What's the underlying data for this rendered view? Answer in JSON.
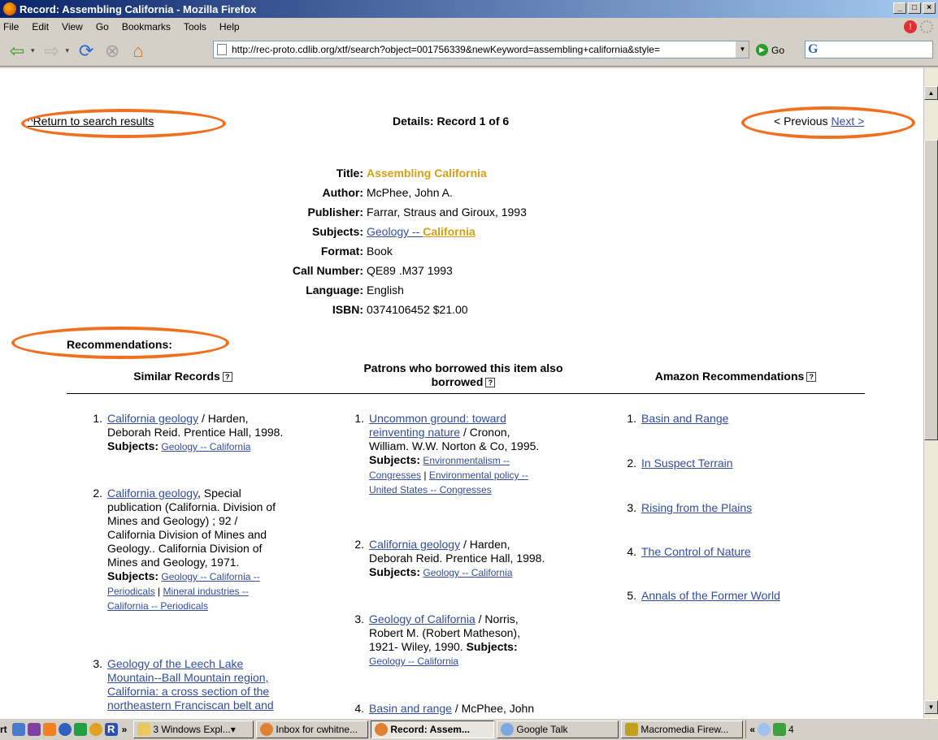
{
  "window": {
    "title": "Record: Assembling California - Mozilla Firefox"
  },
  "menu": [
    "File",
    "Edit",
    "View",
    "Go",
    "Bookmarks",
    "Tools",
    "Help"
  ],
  "toolbar": {
    "url": "http://rec-proto.cdlib.org/xtf/search?object=001756339&newKeyword=assembling+california&style=",
    "go_label": "Go",
    "search_logo": "G"
  },
  "page": {
    "return_link": "^Return to search results",
    "details_heading": "Details: Record 1 of 6",
    "previous": "< Previous",
    "next": "Next >",
    "record": {
      "title_label": "Title:",
      "title": "Assembling California",
      "author_label": "Author:",
      "author": "McPhee, John A.",
      "publisher_label": "Publisher:",
      "publisher": "Farrar, Straus and Giroux, 1993",
      "subjects_label": "Subjects:",
      "subjects_link1": "Geology -- ",
      "subjects_link2": "California",
      "format_label": "Format:",
      "format": "Book",
      "call_label": "Call Number:",
      "call": "QE89 .M37 1993",
      "language_label": "Language:",
      "language": "English",
      "isbn_label": "ISBN:",
      "isbn": "0374106452 $21.00"
    },
    "recommendations_heading": "Recommendations:",
    "columns": {
      "similar": "Similar Records",
      "patrons_line1": "Patrons who borrowed this item also",
      "patrons_line2": "borrowed",
      "amazon": "Amazon Recommendations",
      "help_glyph": "?"
    },
    "similar": [
      {
        "num": "1.",
        "link": "California geology",
        "rest1": " / Harden,",
        "rest2": "Deborah Reid. Prentice Hall, 1998.",
        "subjects_label": "Subjects:",
        "subjects": "Geology -- California"
      },
      {
        "num": "2.",
        "link": "California geology",
        "rest1": ", Special",
        "rest2": "publication (California. Division of",
        "rest3": "Mines and Geology) ; 92 /",
        "rest4": "California Division of Mines and",
        "rest5": "Geology.. California Division of",
        "rest6": "Mines and Geology, 1971.",
        "subjects_label": "Subjects:",
        "subjects1": "Geology -- California --",
        "subjects2": "Periodicals",
        "sep": " | ",
        "subjects3": "Mineral industries --",
        "subjects4": "California -- Periodicals"
      },
      {
        "num": "3.",
        "link1": "Geology of the Leech Lake",
        "link2": "Mountain--Ball Mountain region,",
        "link3": "California: a cross section of the",
        "link4": "northeastern Franciscan belt and"
      }
    ],
    "patrons": [
      {
        "num": "1.",
        "link1": "Uncommon ground: toward",
        "link2": "reinventing nature",
        "rest1": " / Cronon,",
        "rest2": "William. W.W. Norton & Co, 1995.",
        "subjects_label": "Subjects:",
        "subjects1": "Environmentalism --",
        "subjects2": "Congresses",
        "sep": " | ",
        "subjects3": "Environmental policy --",
        "subjects4": "United States -- Congresses"
      },
      {
        "num": "2.",
        "link": "California geology",
        "rest1": " / Harden,",
        "rest2": "Deborah Reid. Prentice Hall, 1998.",
        "subjects_label": "Subjects:",
        "subjects": "Geology -- California"
      },
      {
        "num": "3.",
        "link": "Geology of California",
        "rest1": " / Norris,",
        "rest2": "Robert M. (Robert Matheson),",
        "rest3": "1921- Wiley, 1990.",
        "subjects_label": "Subjects:",
        "subjects": "Geology -- California"
      },
      {
        "num": "4.",
        "link": "Basin and range",
        "rest1": " / McPhee, John"
      }
    ],
    "amazon": [
      {
        "num": "1.",
        "link": "Basin and Range"
      },
      {
        "num": "2.",
        "link": "In Suspect Terrain"
      },
      {
        "num": "3.",
        "link": "Rising from the Plains"
      },
      {
        "num": "4.",
        "link": "The Control of Nature"
      },
      {
        "num": "5.",
        "link": "Annals of the Former World"
      }
    ]
  },
  "taskbar": {
    "start_fragment": "rt",
    "chevron": "»",
    "items": [
      "3 Windows Expl...",
      "Inbox for cwhitne...",
      "Record: Assem...",
      "Google Talk",
      "Macromedia Firew..."
    ],
    "tray_chevron": "«",
    "clock_fragment": "4"
  },
  "colors": {
    "accent_ellipse": "#f07020",
    "link": "#334d9a",
    "gold": "#d4a017"
  }
}
